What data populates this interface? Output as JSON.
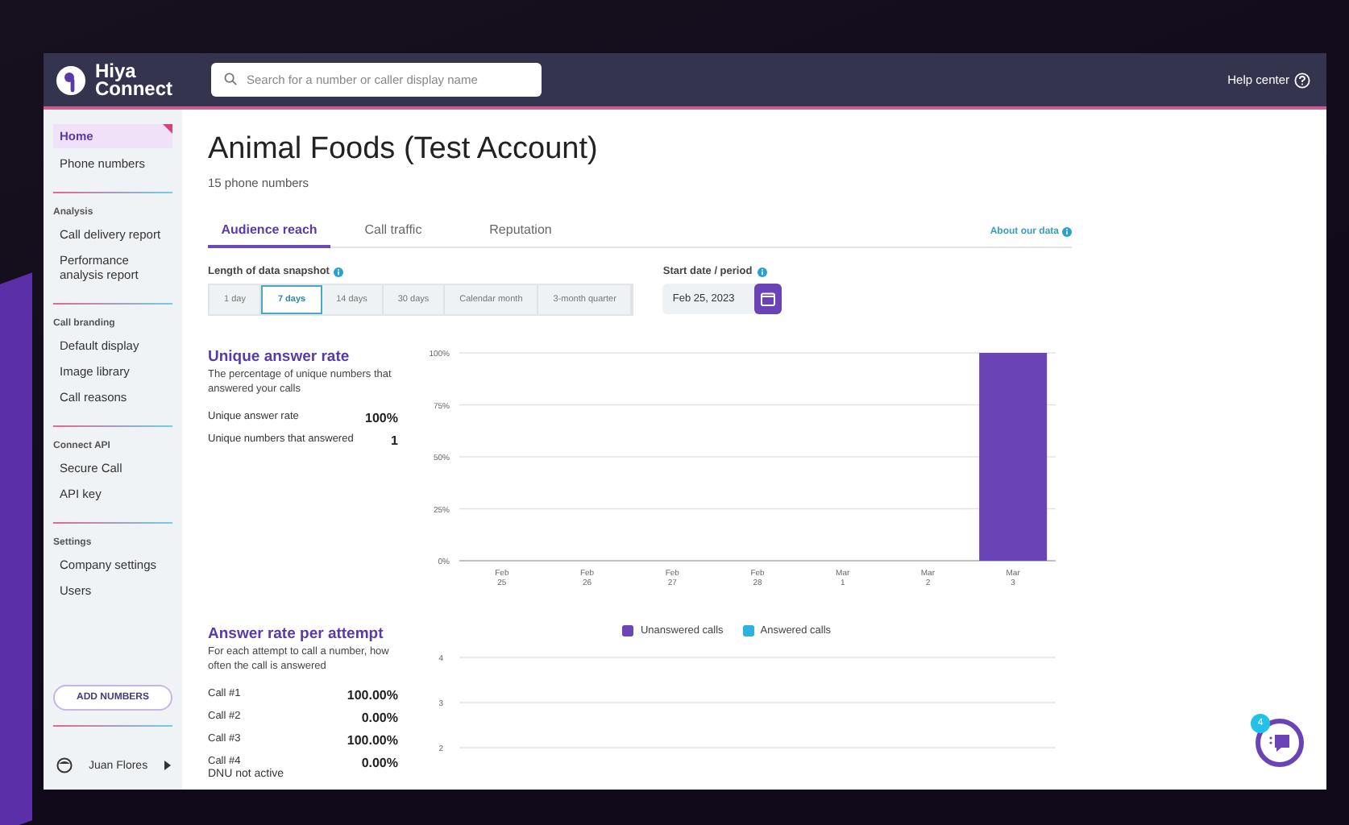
{
  "header": {
    "logo": {
      "line_1": "Hiya",
      "line_2": "Connect"
    },
    "search": {
      "placeholder": "Search for a number or caller display name"
    },
    "help": "Help center"
  },
  "sidebar": {
    "top_items": [
      {
        "label": "Home",
        "selected": true
      },
      {
        "label": "Phone numbers",
        "selected": false
      }
    ],
    "sections": [
      {
        "title": "Analysis",
        "items": [
          {
            "label": "Call delivery report",
            "selected": false
          },
          {
            "label": "Performance analysis report",
            "selected": false
          }
        ]
      },
      {
        "title": "Call branding",
        "items": [
          {
            "label": "Default display",
            "selected": false
          },
          {
            "label": "Image library",
            "selected": false
          },
          {
            "label": "Call reasons",
            "selected": false
          }
        ]
      },
      {
        "title": "Connect API",
        "items": [
          {
            "label": "Secure Call",
            "selected": false
          },
          {
            "label": "API key",
            "selected": false
          }
        ]
      },
      {
        "title": "Settings",
        "items": [
          {
            "label": "Company settings",
            "selected": false
          },
          {
            "label": "Users",
            "selected": false
          }
        ]
      }
    ],
    "add_button": "ADD NUMBERS",
    "user": {
      "name": "Juan Flores"
    }
  },
  "page": {
    "title": "Animal Foods (Test Account)",
    "subtitle": "15 phone numbers",
    "tabs": [
      {
        "label": "Audience reach",
        "selected": true
      },
      {
        "label": "Call traffic",
        "selected": false
      },
      {
        "label": "Reputation",
        "selected": false
      }
    ],
    "about_link": "About our data",
    "snapshot": {
      "label": "Length of data snapshot",
      "options": [
        {
          "label": "1 day",
          "selected": false
        },
        {
          "label": "7 days",
          "selected": true
        },
        {
          "label": "14 days",
          "selected": false
        },
        {
          "label": "30 days",
          "selected": false
        },
        {
          "label": "Calendar month",
          "selected": false
        },
        {
          "label": "3-month quarter",
          "selected": false
        }
      ]
    },
    "start_date": {
      "label": "Start date / period",
      "value": "Feb 25, 2023"
    },
    "unique": {
      "title": "Unique answer rate",
      "description": "The percentage of unique numbers that answered your calls",
      "stats": [
        {
          "label": "Unique answer rate",
          "value": "100%"
        },
        {
          "label": "Unique numbers that answered",
          "value": "1"
        }
      ],
      "chart_data": {
        "type": "bar",
        "categories": [
          "Feb 25",
          "Feb 26",
          "Feb 27",
          "Feb 28",
          "Mar 1",
          "Mar 2",
          "Mar 3"
        ],
        "values": [
          0,
          0,
          0,
          0,
          0,
          0,
          100
        ],
        "ylim": [
          0,
          100
        ],
        "grid": true,
        "yticks": [
          {
            "value": 0,
            "label": "0%"
          },
          {
            "value": 25,
            "label": "25%"
          },
          {
            "value": 50,
            "label": "50%"
          },
          {
            "value": 75,
            "label": "75%"
          },
          {
            "value": 100,
            "label": "100%"
          }
        ]
      }
    },
    "attempt": {
      "title": "Answer rate per attempt",
      "description": "For each attempt to call a number, how often the call is answered",
      "stats": [
        {
          "label": "Call #1",
          "value": "100.00%"
        },
        {
          "label": "Call #2",
          "value": "0.00%"
        },
        {
          "label": "Call #3",
          "value": "100.00%"
        },
        {
          "label": "Call #4",
          "value": "0.00%"
        }
      ],
      "note": "DNU not active",
      "chart_data": {
        "type": "bar",
        "series": [
          {
            "name": "Unanswered calls",
            "color": "#6c45b8"
          },
          {
            "name": "Answered calls",
            "color": "#2bb3de"
          }
        ],
        "ylim": [
          2,
          4
        ],
        "yticks": [
          2,
          3,
          4
        ],
        "grid": true
      }
    },
    "chat": {
      "badge": "4"
    }
  }
}
